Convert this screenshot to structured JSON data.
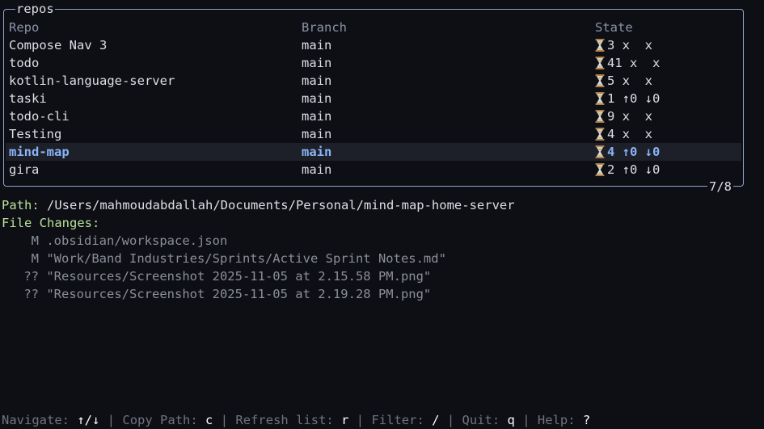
{
  "panel": {
    "title": "repos",
    "counter": "7/8"
  },
  "table": {
    "headers": [
      "Repo",
      "Branch",
      "State"
    ],
    "rows": [
      {
        "repo": "Compose Nav 3",
        "branch": "main",
        "state": "3 x  x"
      },
      {
        "repo": "todo",
        "branch": "main",
        "state": "41 x  x"
      },
      {
        "repo": "kotlin-language-server",
        "branch": "main",
        "state": "5 x  x"
      },
      {
        "repo": "taski",
        "branch": "main",
        "state": "1 ↑0 ↓0"
      },
      {
        "repo": "todo-cli",
        "branch": "main",
        "state": "9 x  x"
      },
      {
        "repo": "Testing",
        "branch": "main",
        "state": "4 x  x"
      },
      {
        "repo": "mind-map",
        "branch": "main",
        "state": "4 ↑0 ↓0"
      },
      {
        "repo": "gira",
        "branch": "main",
        "state": "2 ↑0 ↓0"
      }
    ]
  },
  "details": {
    "path_label": "Path:",
    "path_value": "/Users/mahmoudabdallah/Documents/Personal/mind-map-home-server",
    "changes_label": "File Changes:",
    "changes": [
      {
        "status": "M",
        "file": ".obsidian/workspace.json"
      },
      {
        "status": "M",
        "file": "\"Work/Band Industries/Sprints/Active Sprint Notes.md\""
      },
      {
        "status": "??",
        "file": "\"Resources/Screenshot 2025-11-05 at 2.15.58 PM.png\""
      },
      {
        "status": "??",
        "file": "\"Resources/Screenshot 2025-11-05 at 2.19.28 PM.png\""
      }
    ]
  },
  "footer": {
    "navigate_label": "Navigate:",
    "navigate_key": "↑/↓",
    "copy_label": "Copy Path:",
    "copy_key": "c",
    "refresh_label": "Refresh list:",
    "refresh_key": "r",
    "filter_label": "Filter:",
    "filter_key": "/",
    "quit_label": "Quit:",
    "quit_key": "q",
    "help_label": "Help:",
    "help_key": "?",
    "separator": "|"
  },
  "colors": {
    "background": "#0e0f14",
    "border": "#8fa3c9",
    "selected_text": "#8ab4f8",
    "selected_bg": "#1d2029",
    "label_green": "#b8e39b"
  },
  "icons": {
    "state_icon": "hourglass-icon"
  }
}
